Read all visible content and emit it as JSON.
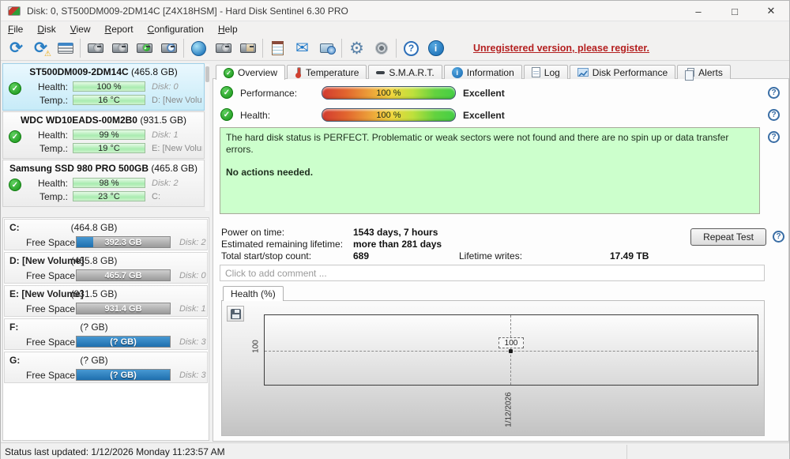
{
  "window": {
    "title": "Disk: 0, ST500DM009-2DM14C [Z4X18HSM]  -  Hard Disk Sentinel 6.30 PRO"
  },
  "icons": {
    "minimize": "–",
    "maximize": "□",
    "close": "✕",
    "refresh": "⟳",
    "warning": "⚠",
    "check": "✓",
    "mail": "✉",
    "gear": "⚙",
    "question": "?",
    "info": "i"
  },
  "menu": {
    "items": [
      "File",
      "Disk",
      "View",
      "Report",
      "Configuration",
      "Help"
    ]
  },
  "toolbar": {
    "register_link": "Unregistered version, please register."
  },
  "labels": {
    "health": "Health:",
    "temp": "Temp.:",
    "free_space": "Free Space"
  },
  "disks": [
    {
      "name": "ST500DM009-2DM14C",
      "size": "(465.8 GB)",
      "health": "100 %",
      "disk": "Disk: 0",
      "temp": "16 °C",
      "volume": "D: [New Volume]"
    },
    {
      "name": "WDC WD10EADS-00M2B0",
      "size": "(931.5 GB)",
      "health": "99 %",
      "disk": "Disk: 1",
      "temp": "19 °C",
      "volume": "E: [New Volume]"
    },
    {
      "name": "Samsung SSD 980 PRO 500GB",
      "size": "(465.8 GB)",
      "health": "98 %",
      "disk": "Disk: 2",
      "temp": "23 °C",
      "volume": "C:"
    }
  ],
  "partitions": [
    {
      "name": "C:",
      "size": "(464.8 GB)",
      "free": "392.3 GB",
      "disk": "Disk: 2"
    },
    {
      "name": "D: [New Volume]",
      "size": "(465.8 GB)",
      "free": "465.7 GB",
      "disk": "Disk: 0"
    },
    {
      "name": "E: [New Volume]",
      "size": "(931.5 GB)",
      "free": "931.4 GB",
      "disk": "Disk: 1"
    },
    {
      "name": "F:",
      "size": "(? GB)",
      "free": "(? GB)",
      "disk": "Disk: 3"
    },
    {
      "name": "G:",
      "size": "(? GB)",
      "free": "(? GB)",
      "disk": "Disk: 3"
    }
  ],
  "tabs": [
    {
      "label": "Overview"
    },
    {
      "label": "Temperature"
    },
    {
      "label": "S.M.A.R.T."
    },
    {
      "label": "Information"
    },
    {
      "label": "Log"
    },
    {
      "label": "Disk Performance"
    },
    {
      "label": "Alerts"
    }
  ],
  "overview": {
    "performance_label": "Performance:",
    "performance_value": "100 %",
    "performance_rating": "Excellent",
    "health_label": "Health:",
    "health_value": "100 %",
    "health_rating": "Excellent",
    "status_text": "The hard disk status is PERFECT. Problematic or weak sectors were not found and there are no spin up or data transfer errors.",
    "status_action": "No actions needed.",
    "power_on_label": "Power on time:",
    "power_on_value": "1543 days, 7 hours",
    "remaining_label": "Estimated remaining lifetime:",
    "remaining_value": "more than 281 days",
    "startstop_label": "Total start/stop count:",
    "startstop_value": "689",
    "writes_label": "Lifetime writes:",
    "writes_value": "17.49 TB",
    "repeat_test_label": "Repeat Test",
    "comment_placeholder": "Click to add comment ..."
  },
  "chart_data": {
    "type": "line",
    "title": "Health (%)",
    "x": [
      "1/12/2026"
    ],
    "values": [
      100
    ],
    "yticks": [
      "100"
    ],
    "point_label": "100",
    "grid": "dashed",
    "legend": "none"
  },
  "statusbar": {
    "text": "Status last updated: 1/12/2026 Monday 11:23:57 AM"
  },
  "colors": {
    "accent_blue": "#2b87c8",
    "health_green": "#a9ecb0",
    "status_bg": "#ccffcc",
    "register_red": "#b42020"
  }
}
